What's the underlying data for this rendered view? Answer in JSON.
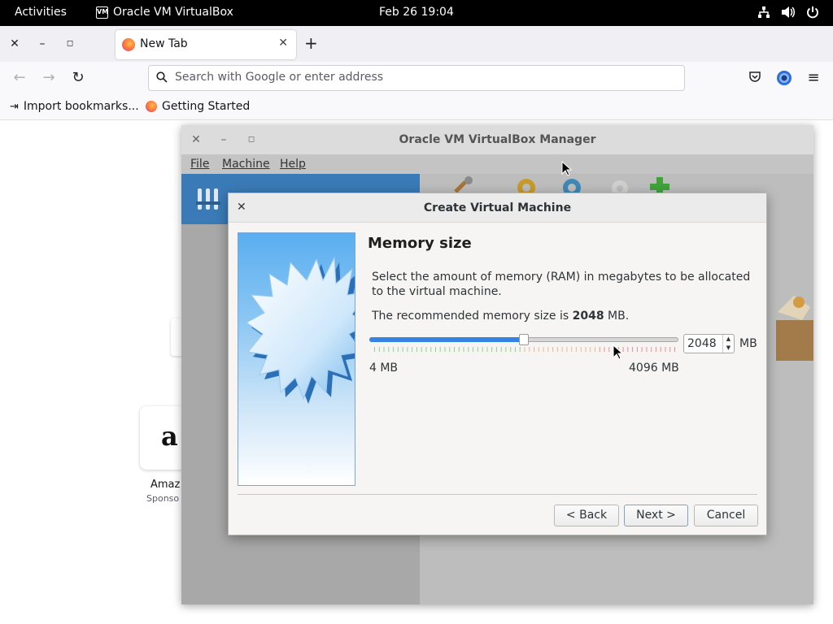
{
  "topbar": {
    "activities": "Activities",
    "app_name": "Oracle VM VirtualBox",
    "clock": "Feb 26  19:04",
    "tray_icons": [
      "network-icon",
      "volume-icon",
      "power-icon"
    ]
  },
  "firefox": {
    "window_controls": [
      "close",
      "minimize",
      "maximize"
    ],
    "tab": {
      "title": "New Tab"
    },
    "urlbar": {
      "placeholder": "Search with Google or enter address"
    },
    "bookmarks": [
      {
        "label": "Import bookmarks..."
      },
      {
        "label": "Getting Started"
      }
    ],
    "newtab": {
      "tile_letter": "a",
      "tile_label": "Amaz",
      "tile_sub": "Sponso"
    }
  },
  "vbox_manager": {
    "title": "Oracle VM VirtualBox Manager",
    "menu": [
      {
        "label": "File"
      },
      {
        "label": "Machine"
      },
      {
        "label": "Help"
      }
    ]
  },
  "dialog": {
    "title": "Create Virtual Machine",
    "heading": "Memory size",
    "description": "Select the amount of memory (RAM) in megabytes to be allocated to the virtual machine.",
    "recommended_prefix": "The recommended memory size is ",
    "recommended_value": "2048",
    "recommended_suffix": " MB.",
    "memory": {
      "value": "2048",
      "unit": "MB",
      "min_label": "4 MB",
      "max_label": "4096 MB",
      "min": 4,
      "max": 4096,
      "current": 2048
    },
    "buttons": {
      "back": "< Back",
      "next": "Next >",
      "cancel": "Cancel"
    }
  },
  "colors": {
    "accent": "#3584e4",
    "selection": "#3a7ab6",
    "tick_green": "#8fd18f",
    "tick_orange": "#f2b58c",
    "tick_red": "#f08c8c"
  }
}
